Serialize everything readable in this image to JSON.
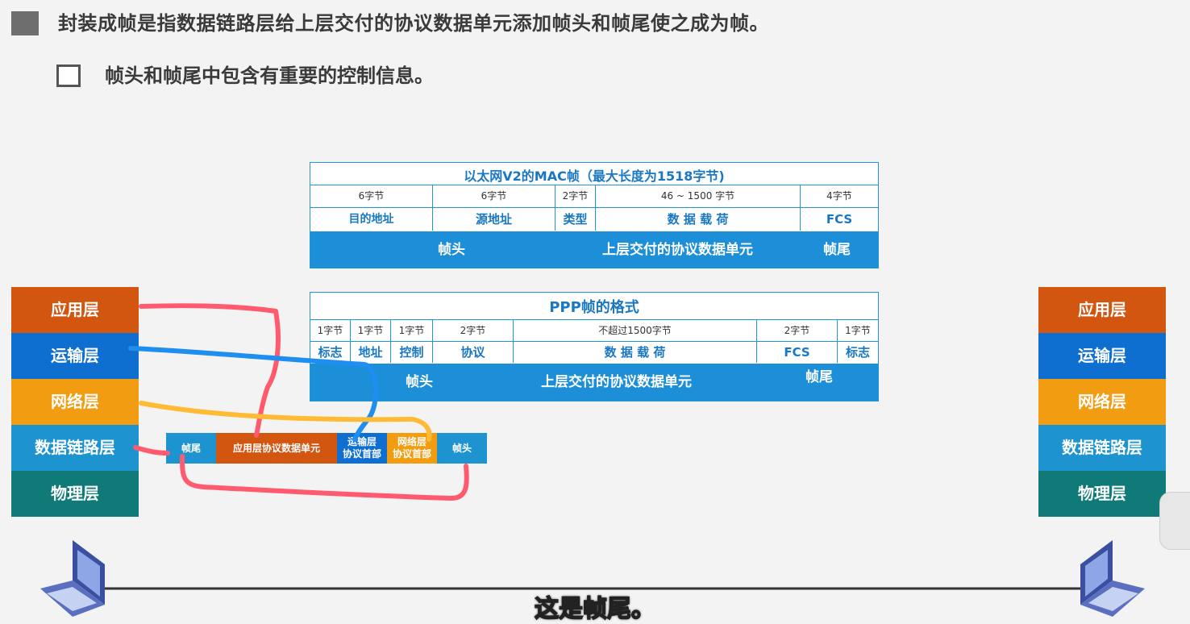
{
  "heading": {
    "line1": "封装成帧是指数据链路层给上层交付的协议数据单元添加帧头和帧尾使之成为帧。",
    "line2": "帧头和帧尾中包含有重要的控制信息。"
  },
  "ethernet_frame": {
    "title": "以太网V2的MAC帧（最大长度为1518字节)",
    "sizes": [
      "6字节",
      "6字节",
      "2字节",
      "46 ~ 1500 字节",
      "4字节"
    ],
    "fields": [
      "目的地址",
      "源地址",
      "类型",
      "数 据 载 荷",
      "FCS"
    ],
    "bar": {
      "header": "帧头",
      "payload": "上层交付的协议数据单元",
      "trailer": "帧尾"
    }
  },
  "ppp_frame": {
    "title": "PPP帧的格式",
    "sizes": [
      "1字节",
      "1字节",
      "1字节",
      "2字节",
      "不超过1500字节",
      "2字节",
      "1字节"
    ],
    "fields": [
      "标志",
      "地址",
      "控制",
      "协议",
      "数 据 载 荷",
      "FCS",
      "标志"
    ],
    "bar": {
      "header": "帧头",
      "payload": "上层交付的协议数据单元",
      "trailer": "帧尾"
    }
  },
  "layers_left": [
    "应用层",
    "运输层",
    "网络层",
    "数据链路层",
    "物理层"
  ],
  "layers_right": [
    "应用层",
    "运输层",
    "网络层",
    "数据链路层",
    "物理层"
  ],
  "strip": {
    "trailer": "帧尾",
    "app_pdu": "应用层协议数据单元",
    "transport": [
      "运输层",
      "协议首部"
    ],
    "network": [
      "网络层",
      "协议首部"
    ],
    "header": "帧头"
  },
  "subtitle": "这是帧尾。",
  "colors": {
    "app": "#d25510",
    "transport": "#0f6fd0",
    "network": "#f29c12",
    "datalink": "#1d94cf",
    "physical": "#0f7a78",
    "annot_red": "#ff5a6e",
    "annot_blue": "#1e8ef0",
    "annot_yellow": "#ffbb33"
  }
}
